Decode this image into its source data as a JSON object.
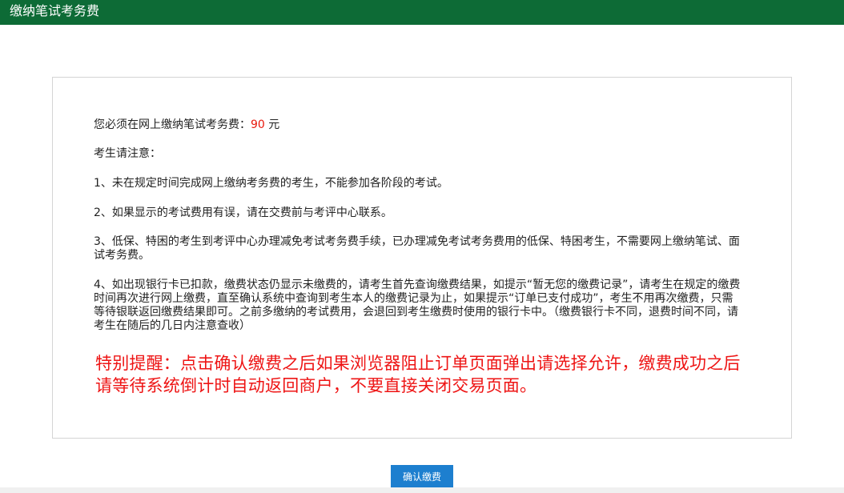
{
  "header": {
    "title": "缴纳笔试考务费"
  },
  "notice": {
    "fee_prefix": "您必须在网上缴纳笔试考务费：",
    "fee_amount": "90",
    "fee_unit": " 元",
    "attention": "考生请注意：",
    "items": [
      "1、未在规定时间完成网上缴纳考务费的考生，不能参加各阶段的考试。",
      "2、如果显示的考试费用有误，请在交费前与考评中心联系。",
      "3、低保、特困的考生到考评中心办理减免考试考务费手续，已办理减免考试考务费用的低保、特困考生，不需要网上缴纳笔试、面试考务费。",
      "4、如出现银行卡已扣款，缴费状态仍显示未缴费的，请考生首先查询缴费结果，如提示“暂无您的缴费记录”，请考生在规定的缴费时间再次进行网上缴费，直至确认系统中查询到考生本人的缴费记录为止，如果提示“订单已支付成功”，考生不用再次缴费，只需等待银联返回缴费结果即可。之前多缴纳的考试费用，会退回到考生缴费时使用的银行卡中。（缴费银行卡不同，退费时间不同，请考生在随后的几日内注意查收）"
    ],
    "special_reminder": "特别提醒：点击确认缴费之后如果浏览器阻止订单页面弹出请选择允许，缴费成功之后请等待系统倒计时自动返回商户，不要直接关闭交易页面。"
  },
  "actions": {
    "confirm_label": "确认缴费"
  },
  "colors": {
    "header_bg": "#0d6b36",
    "amount_red": "#e8180c",
    "reminder_red": "#ee1414",
    "button_blue": "#1d7fcf"
  }
}
